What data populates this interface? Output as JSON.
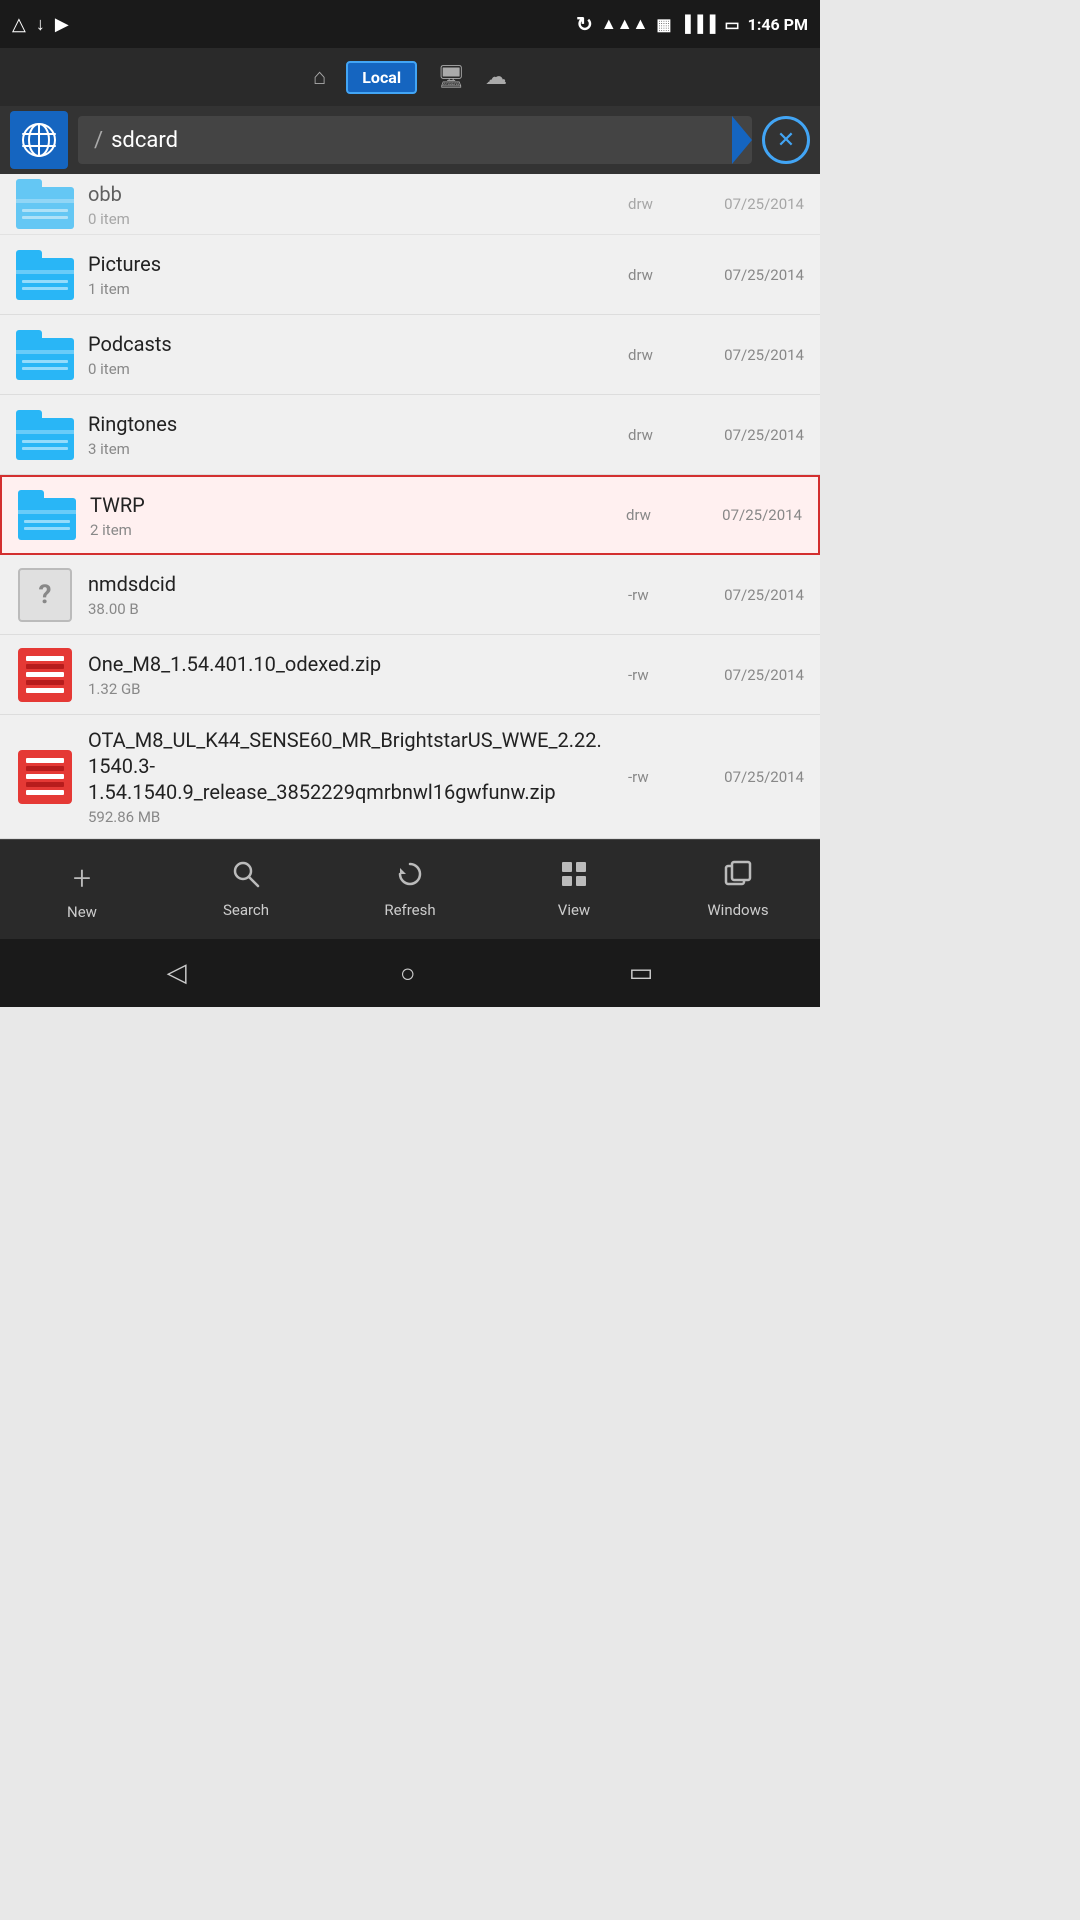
{
  "statusBar": {
    "time": "1:46 PM",
    "icons": {
      "notif1": "△",
      "notif2": "↓",
      "media": "▶",
      "sync": "↻",
      "wifi": "WiFi",
      "storage": "💾",
      "signal": "▐▐▐",
      "battery": "🔋"
    }
  },
  "navBar": {
    "home": "🏠",
    "location": "Local",
    "device": "🖥",
    "cloud": "☁"
  },
  "pathBar": {
    "globe": "🌐",
    "separator": "/",
    "path": "sdcard",
    "closeBtn": "✕"
  },
  "files": [
    {
      "name": "obb",
      "meta": "0 item",
      "perms": "drw",
      "date": "07/25/2014",
      "type": "folder",
      "partial": true
    },
    {
      "name": "Pictures",
      "meta": "1 item",
      "perms": "drw",
      "date": "07/25/2014",
      "type": "folder"
    },
    {
      "name": "Podcasts",
      "meta": "0 item",
      "perms": "drw",
      "date": "07/25/2014",
      "type": "folder"
    },
    {
      "name": "Ringtones",
      "meta": "3 item",
      "perms": "drw",
      "date": "07/25/2014",
      "type": "folder"
    },
    {
      "name": "TWRP",
      "meta": "2 item",
      "perms": "drw",
      "date": "07/25/2014",
      "type": "folder",
      "selected": true
    },
    {
      "name": "nmdsdcid",
      "meta": "38.00 B",
      "perms": "-rw",
      "date": "07/25/2014",
      "type": "unknown"
    },
    {
      "name": "One_M8_1.54.401.10_odexed.zip",
      "meta": "1.32 GB",
      "perms": "-rw",
      "date": "07/25/2014",
      "type": "zip"
    },
    {
      "name": "OTA_M8_UL_K44_SENSE60_MR_BrightstarUS_WWE_2.22.1540.3-1.54.1540.9_release_3852229qmrbnwl16gwfunw.zip",
      "meta": "592.86 MB",
      "perms": "-rw",
      "date": "07/25/2014",
      "type": "zip"
    }
  ],
  "toolbar": {
    "buttons": [
      {
        "id": "new",
        "label": "New",
        "icon": "+"
      },
      {
        "id": "search",
        "label": "Search",
        "icon": "🔍"
      },
      {
        "id": "refresh",
        "label": "Refresh",
        "icon": "↻"
      },
      {
        "id": "view",
        "label": "View",
        "icon": "⊞"
      },
      {
        "id": "windows",
        "label": "Windows",
        "icon": "❐"
      }
    ]
  },
  "sysNav": {
    "back": "◁",
    "home": "○",
    "recents": "□"
  }
}
